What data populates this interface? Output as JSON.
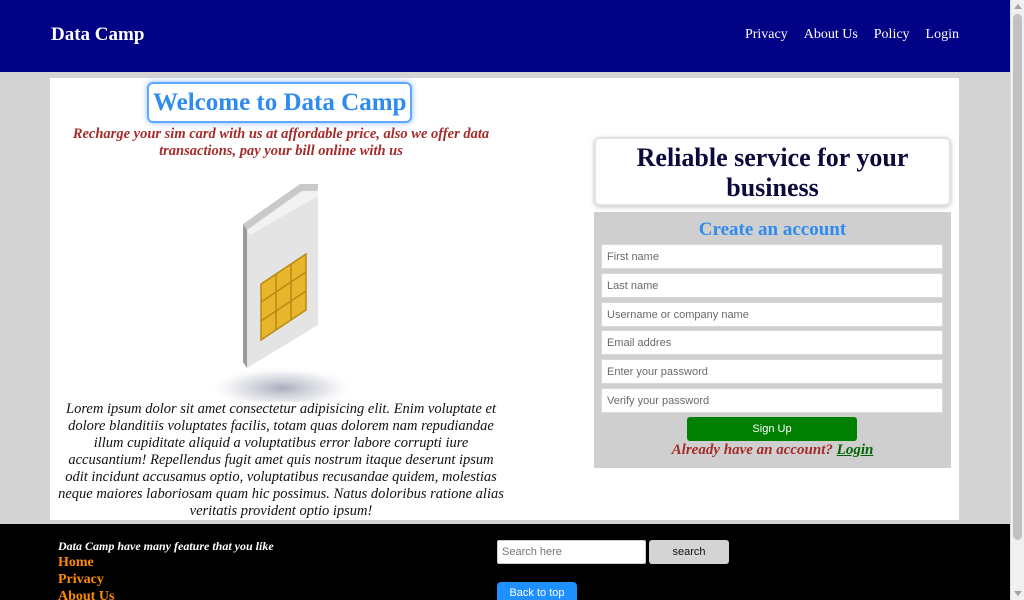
{
  "header": {
    "brand": "Data Camp",
    "nav": [
      "Privacy",
      "About Us",
      "Policy",
      "Login"
    ]
  },
  "hero": {
    "title": "Welcome to Data Camp",
    "tagline": "Recharge your sim card with us at affordable price, also we offer data transactions, pay your bill online with us",
    "image": "sim-card-illustration",
    "body": "Lorem ipsum dolor sit amet consectetur adipisicing elit. Enim voluptate et dolore blanditiis voluptates facilis, totam quas dolorem nam repudiandae illum cupiditate aliquid a voluptatibus error labore corrupti iure accusantium! Repellendus fugit amet quis nostrum itaque deserunt ipsum odit incidunt accusamus optio, voluptatibus recusandae quidem, molestias neque maiores laboriosam quam hic possimus. Natus doloribus ratione alias veritatis provident optio ipsum!"
  },
  "signup": {
    "headline": "Reliable service for your business",
    "title": "Create an account",
    "fields": [
      "First name",
      "Last name",
      "Username or company name",
      "Email addres",
      "Enter your password",
      "Verify your password"
    ],
    "button": "Sign Up",
    "have_account": "Already have an account?",
    "login_link": "Login"
  },
  "footer": {
    "feature_text": "Data Camp have many feature that you like",
    "links": [
      "Home",
      "Privacy",
      "About Us"
    ],
    "search_placeholder": "Search here",
    "search_button": "search",
    "back_to_top": "Back to top"
  },
  "colors": {
    "header_bg": "#020286",
    "title_blue": "#2f8bef",
    "accent_red": "#a52a2a",
    "signup_green": "#008000",
    "footer_link_orange": "#ff8c00"
  }
}
